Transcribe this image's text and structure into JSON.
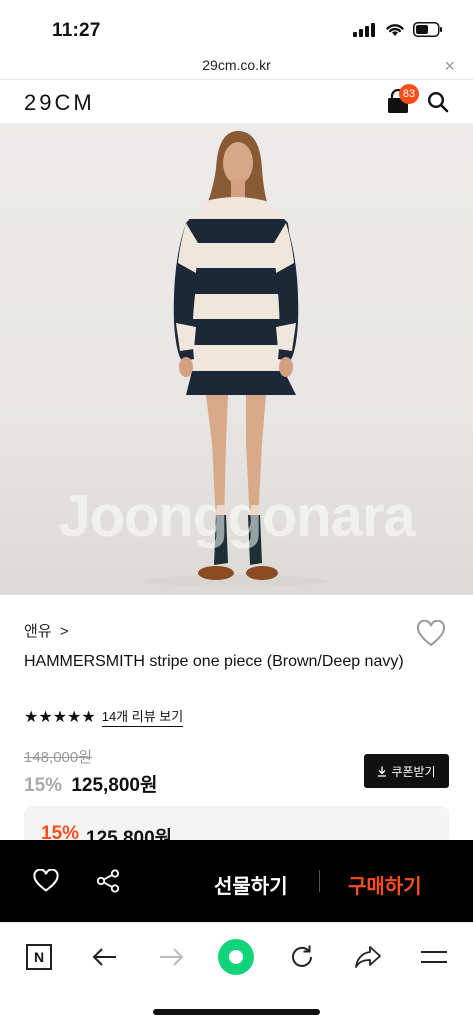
{
  "status": {
    "time": "11:27"
  },
  "url_bar": {
    "domain": "29cm.co.kr",
    "close_glyph": "×"
  },
  "header": {
    "logo": "29CM",
    "cart_count": "83"
  },
  "hero": {
    "watermark": "Joonggonara"
  },
  "product": {
    "brand": "앤유",
    "brand_arrow": ">",
    "name": "HAMMERSMITH stripe one piece (Brown/Deep navy)",
    "stars": "★★★★★",
    "review_link": "14개 리뷰 보기",
    "original_price": "148,000원",
    "discount": "15%",
    "price": "125,800원",
    "coupon_label": "쿠폰받기"
  },
  "promo": {
    "discount": "15%",
    "price": "125,800원"
  },
  "action_bar": {
    "gift_label": "선물하기",
    "buy_label": "구매하기"
  },
  "browser_bar": {
    "n_label": "N"
  },
  "colors": {
    "accent": "#ff4e1b",
    "dark": "#000000",
    "navy": "#1c2838",
    "cream": "#efe7dc"
  },
  "icons": [
    "signal-icon",
    "wifi-icon",
    "battery-icon",
    "close-icon",
    "cart-icon",
    "search-icon",
    "heart-icon",
    "share-icon",
    "download-icon",
    "back-icon",
    "forward-icon",
    "refresh-icon",
    "share-arrow-icon",
    "menu-icon"
  ]
}
